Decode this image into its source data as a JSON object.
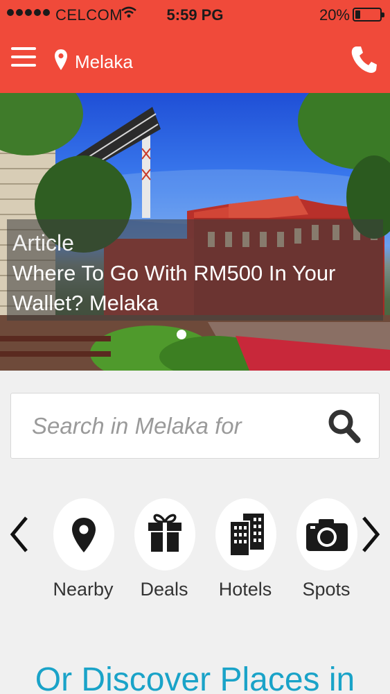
{
  "status_bar": {
    "carrier": "CELCOM",
    "time": "5:59 PG",
    "battery_percent_label": "20%",
    "battery_level": 0.2
  },
  "header": {
    "location": "Melaka",
    "icons": {
      "menu": "hamburger-menu-icon",
      "location": "map-pin-icon",
      "phone": "phone-icon"
    }
  },
  "hero": {
    "kicker": "Article",
    "title": "Where To Go With RM500 In Your Wallet? Melaka",
    "carousel_active_index": 0,
    "carousel_count": 1
  },
  "search": {
    "placeholder": "Search in Melaka for",
    "icon": "search-icon"
  },
  "categories": {
    "items": [
      {
        "label": "Nearby",
        "icon": "map-pin-icon"
      },
      {
        "label": "Deals",
        "icon": "gift-icon"
      },
      {
        "label": "Hotels",
        "icon": "buildings-icon"
      },
      {
        "label": "Spots",
        "icon": "camera-icon"
      }
    ]
  },
  "discover_heading": "Or Discover Places in",
  "colors": {
    "brand_red": "#f04a3a",
    "accent_teal": "#1aa3c8",
    "background": "#f0f0f0"
  }
}
